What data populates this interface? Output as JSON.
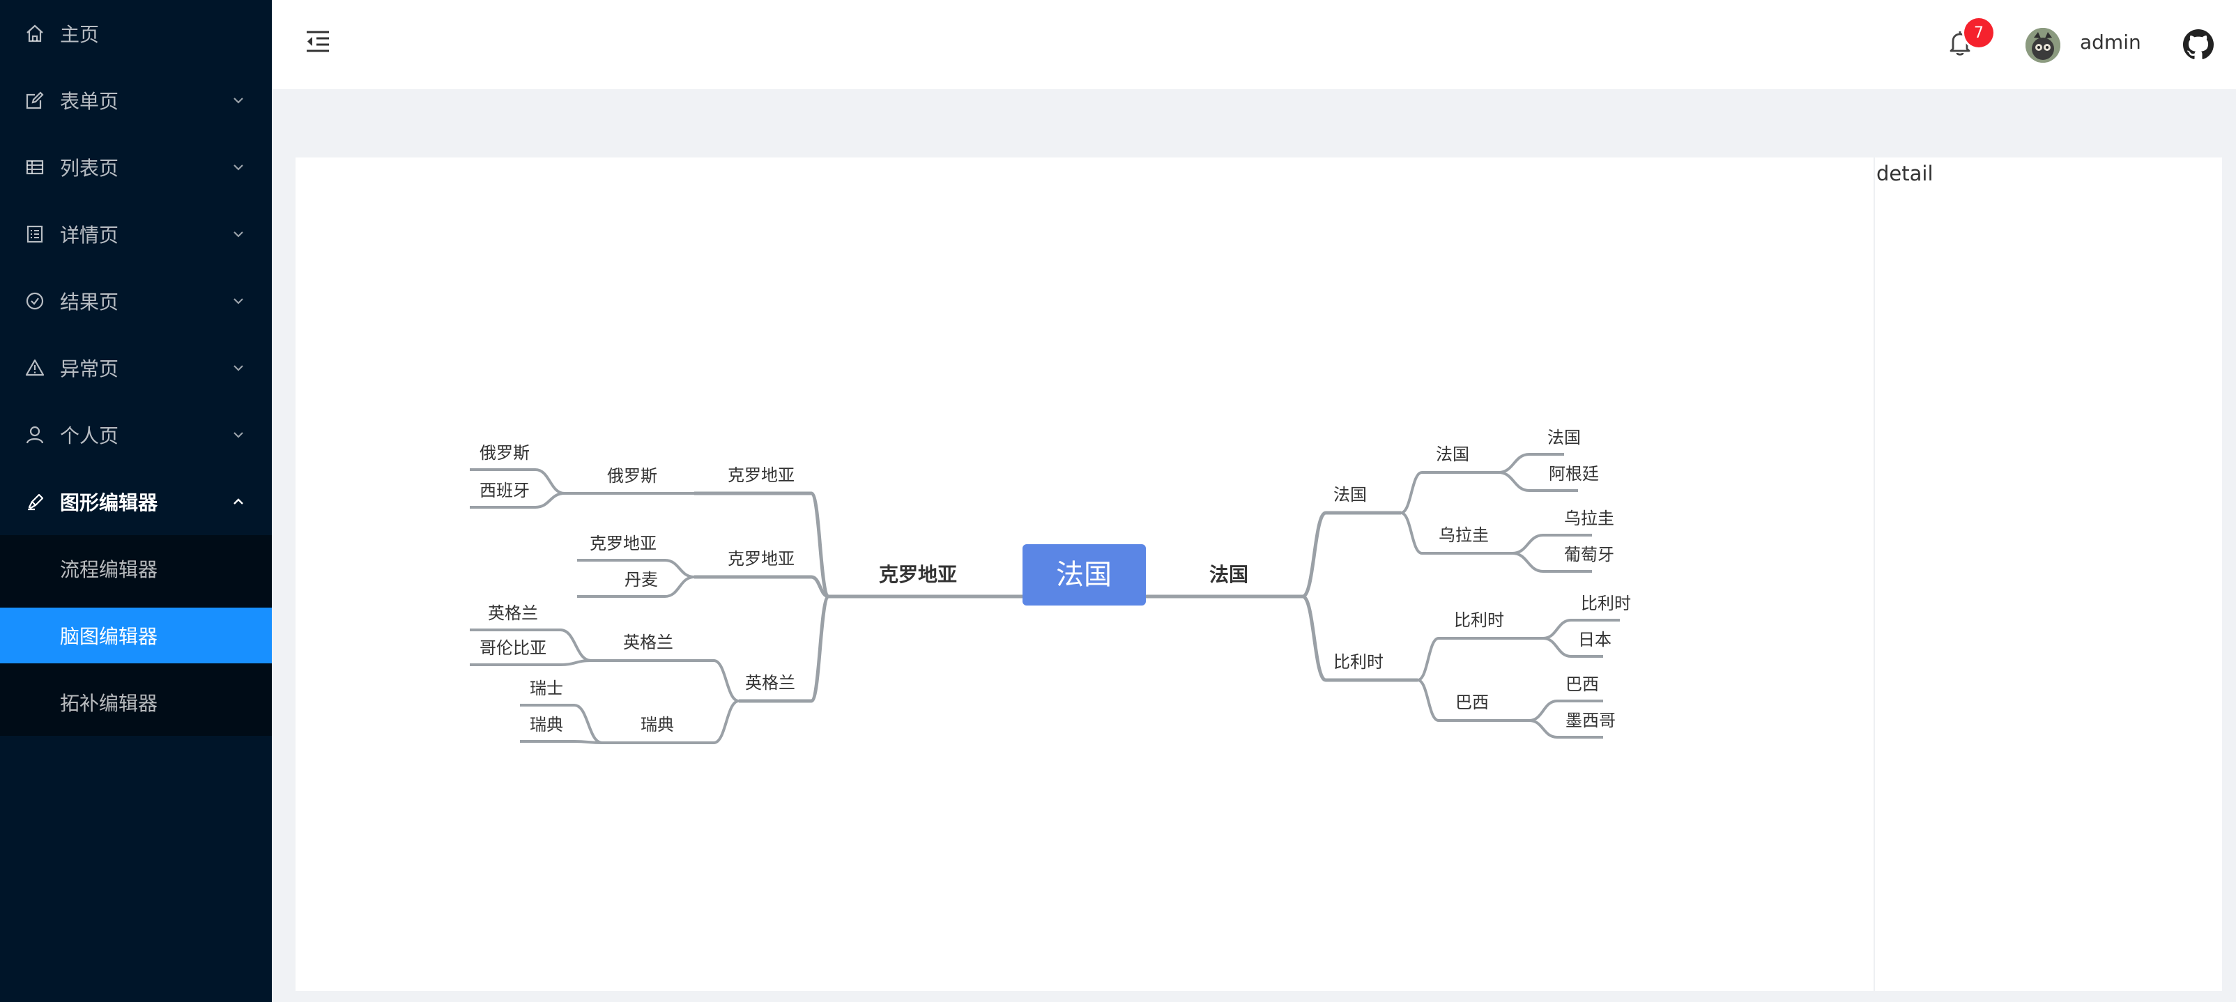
{
  "sidebar": {
    "items": [
      {
        "label": "主页",
        "icon": "home-icon",
        "has_submenu": false
      },
      {
        "label": "表单页",
        "icon": "edit-icon",
        "has_submenu": true
      },
      {
        "label": "列表页",
        "icon": "table-icon",
        "has_submenu": true
      },
      {
        "label": "详情页",
        "icon": "profile-icon",
        "has_submenu": true
      },
      {
        "label": "结果页",
        "icon": "check-circle-icon",
        "has_submenu": true
      },
      {
        "label": "异常页",
        "icon": "warning-icon",
        "has_submenu": true
      },
      {
        "label": "个人页",
        "icon": "user-icon",
        "has_submenu": true
      },
      {
        "label": "图形编辑器",
        "icon": "highlight-icon",
        "has_submenu": true,
        "open": true
      }
    ],
    "submenu": [
      {
        "label": "流程编辑器",
        "active": false
      },
      {
        "label": "脑图编辑器",
        "active": true
      },
      {
        "label": "拓补编辑器",
        "active": false
      }
    ]
  },
  "header": {
    "notification_count": "7",
    "username": "admin",
    "icons": [
      "menu-fold-icon",
      "bell-icon",
      "avatar",
      "github-icon"
    ]
  },
  "editor": {
    "detail_title": "detail",
    "mindmap": {
      "root": "法国",
      "left_branch": {
        "label": "克罗地亚",
        "children": [
          {
            "label": "克罗地亚",
            "children": [
              {
                "label": "俄罗斯",
                "children": [
                  "俄罗斯",
                  "西班牙"
                ]
              }
            ]
          },
          {
            "label": "克罗地亚",
            "children": [
              "克罗地亚",
              "丹麦"
            ]
          },
          {
            "label": "英格兰",
            "children": [
              {
                "label": "英格兰",
                "children": [
                  "英格兰",
                  "哥伦比亚"
                ]
              },
              {
                "label": "瑞典",
                "children": [
                  "瑞士",
                  "瑞典"
                ]
              }
            ]
          }
        ]
      },
      "right_branch": {
        "label": "法国",
        "children": [
          {
            "label": "法国",
            "children": [
              {
                "label": "法国",
                "children": [
                  "法国",
                  "阿根廷"
                ]
              },
              {
                "label": "乌拉圭",
                "children": [
                  "乌拉圭",
                  "葡萄牙"
                ]
              }
            ]
          },
          {
            "label": "比利时",
            "children": [
              {
                "label": "比利时",
                "children": [
                  "比利时",
                  "日本"
                ]
              },
              {
                "label": "巴西",
                "children": [
                  "巴西",
                  "墨西哥"
                ]
              }
            ]
          }
        ]
      }
    }
  },
  "colors": {
    "sidebar_bg": "#001529",
    "submenu_bg": "#000c17",
    "active": "#1890ff",
    "root_node": "#5b86e5",
    "edge": "#9aa0a6",
    "badge": "#f5222d"
  }
}
